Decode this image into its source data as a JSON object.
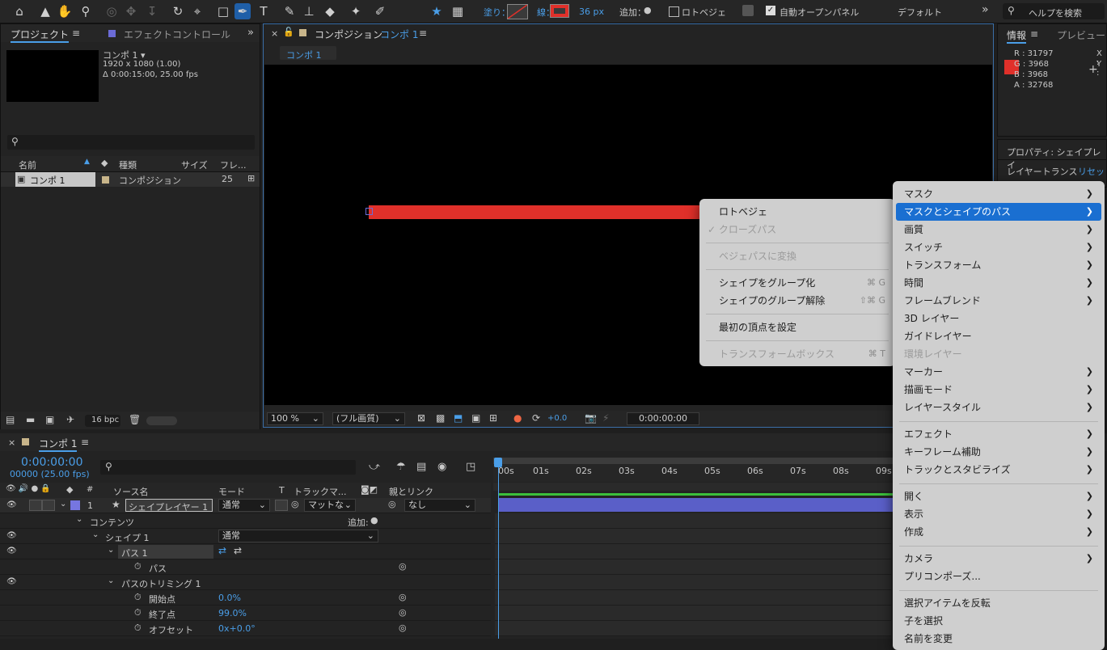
{
  "toolbar": {
    "fill_label": "塗り：",
    "stroke_label": "線：",
    "stroke_width": "36 px",
    "add_label": "追加：",
    "rotobezier": "ロトベジェ",
    "auto_open_panel": "自動オープンパネル",
    "workspace": "デフォルト",
    "search_help": "ヘルプを検索",
    "stroke_color": "#e0302a"
  },
  "project_panel": {
    "tab_project": "プロジェクト",
    "tab_effects": "エフェクトコントロール",
    "comp_name": "コンポ 1 ▾",
    "comp_res": "1920 x 1080 (1.00)",
    "comp_dur": "Δ 0:00:15:00, 25.00 fps",
    "col_name": "名前",
    "col_type": "種類",
    "col_size": "サイズ",
    "col_fps": "フレ...",
    "item_name": "コンポ 1",
    "item_type": "コンポジション",
    "item_fps": "25",
    "bpc": "16 bpc"
  },
  "comp_panel": {
    "title": "コンポジション",
    "title_comp": "コンポ 1",
    "tab": "コンポ 1",
    "zoom": "100 %",
    "quality": "(フル画質)",
    "exposure": "+0.0",
    "timecode": "0:00:00:00"
  },
  "info_panel": {
    "tab_info": "情報",
    "tab_preview": "プレビュー",
    "r": "R :  31797",
    "g": "G :  3968",
    "b": "B :  3968",
    "a": "A :  32768",
    "x": "X :",
    "y": "Y :",
    "swatch_color": "#e0302a",
    "properties_title": "プロパティ: シェイプレイ",
    "layer_transform": "レイヤートランス",
    "reset": "リセッ"
  },
  "timeline": {
    "tab": "コンポ 1",
    "timecode": "0:00:00:00",
    "fps": "00000 (25.00 fps)",
    "col_source": "ソース名",
    "col_mode": "モード",
    "col_t": "T",
    "col_track": "トラックマ...",
    "col_parent": "親とリンク",
    "layer_num": "1",
    "layer_name": "シェイプレイヤー 1",
    "layer_mode": "通常",
    "layer_matte": "マットな",
    "layer_parent": "なし",
    "contents": "コンテンツ",
    "add": "追加:",
    "shape1": "シェイプ 1",
    "shape1_mode": "通常",
    "path1": "パス 1",
    "path": "パス",
    "trim": "パスのトリミング 1",
    "start_label": "開始点",
    "start_val": "0.0%",
    "end_label": "終了点",
    "end_val": "99.0%",
    "offset_label": "オフセット",
    "offset_val": "0x+0.0°",
    "ruler": [
      "00s",
      "01s",
      "02s",
      "03s",
      "04s",
      "05s",
      "06s",
      "07s",
      "08s",
      "09s"
    ]
  },
  "submenu": {
    "rotobezier": "ロトベジェ",
    "closed_path": "✓ クローズパス",
    "convert_bezier": "ベジェパスに変換",
    "group": "シェイプをグループ化",
    "group_sc": "⌘ G",
    "ungroup": "シェイプのグループ解除",
    "ungroup_sc": "⇧⌘ G",
    "first_vertex": "最初の頂点を設定",
    "transform_box": "トランスフォームボックス",
    "transform_sc": "⌘ T"
  },
  "context_menu": {
    "items": [
      "マスク",
      "マスクとシェイプのパス",
      "画質",
      "スイッチ",
      "トランスフォーム",
      "時間",
      "フレームブレンド",
      "3D レイヤー",
      "ガイドレイヤー",
      "環境レイヤー",
      "マーカー",
      "描画モード",
      "レイヤースタイル",
      "エフェクト",
      "キーフレーム補助",
      "トラックとスタビライズ",
      "開く",
      "表示",
      "作成",
      "カメラ",
      "プリコンポーズ...",
      "選択アイテムを反転",
      "子を選択",
      "名前を変更"
    ]
  }
}
